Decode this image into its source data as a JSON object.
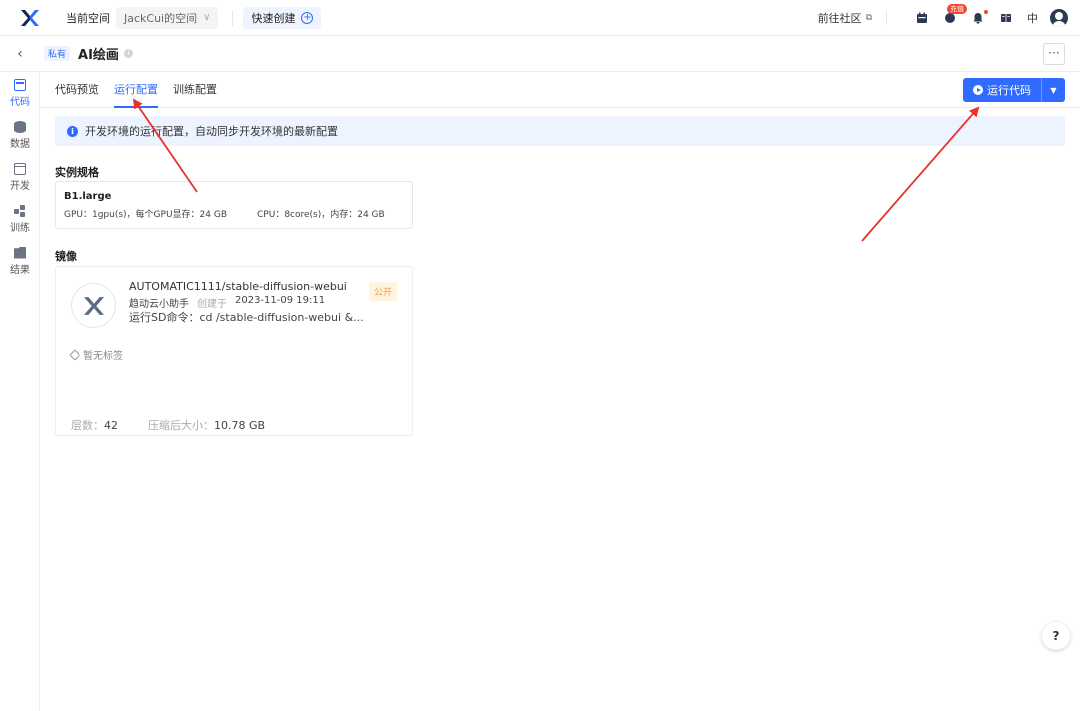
{
  "topbar": {
    "space_label": "当前空间",
    "space_name": "JackCui的空间",
    "quick_create": "快速创建",
    "community": "前往社区",
    "charge_badge": "充值",
    "lang": "中"
  },
  "titlebar": {
    "private_tag": "私有",
    "title": "AI绘画"
  },
  "sidebar": {
    "items": [
      {
        "label": "代码",
        "icon": "code-icon"
      },
      {
        "label": "数据",
        "icon": "database-icon"
      },
      {
        "label": "开发",
        "icon": "dev-icon"
      },
      {
        "label": "训练",
        "icon": "train-icon"
      },
      {
        "label": "结果",
        "icon": "folder-icon"
      }
    ]
  },
  "tabs": {
    "items": [
      "代码预览",
      "运行配置",
      "训练配置"
    ],
    "active": "运行配置",
    "run_button": "运行代码"
  },
  "notice": "开发环境的运行配置，自动同步开发环境的最新配置",
  "spec": {
    "section_title": "实例规格",
    "name": "B1.large",
    "gpu": "GPU：1gpu(s)，每个GPU显存：24 GB",
    "cpu": "CPU：8core(s)，内存：24 GB"
  },
  "image": {
    "section_title": "镜像",
    "name": "AUTOMATIC1111/stable-diffusion-webui",
    "author": "趋动云小助手",
    "created_label": "创建于",
    "created_at": "2023-11-09 19:11",
    "command": "运行SD命令：cd /stable-diffusion-webui &...",
    "visibility": "公开",
    "no_tag": "暂无标签",
    "layers_label": "层数：",
    "layers": "42",
    "size_label": "压缩后大小：",
    "size": "10.78 GB"
  },
  "help": "?",
  "colors": {
    "accent": "#2f6bff",
    "annotation_arrow": "#e8332a",
    "public_tag": "#e8a23a"
  }
}
